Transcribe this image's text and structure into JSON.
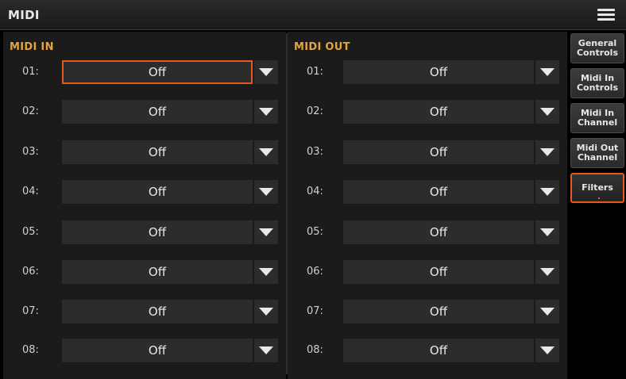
{
  "window": {
    "title": "MIDI",
    "menu_icon": "hamburger-menu-icon"
  },
  "midi_in": {
    "title": "MIDI IN",
    "rows": [
      {
        "label": "01:",
        "value": "Off"
      },
      {
        "label": "02:",
        "value": "Off"
      },
      {
        "label": "03:",
        "value": "Off"
      },
      {
        "label": "04:",
        "value": "Off"
      },
      {
        "label": "05:",
        "value": "Off"
      },
      {
        "label": "06:",
        "value": "Off"
      },
      {
        "label": "07:",
        "value": "Off"
      },
      {
        "label": "08:",
        "value": "Off"
      }
    ]
  },
  "midi_out": {
    "title": "MIDI OUT",
    "rows": [
      {
        "label": "01:",
        "value": "Off"
      },
      {
        "label": "02:",
        "value": "Off"
      },
      {
        "label": "03:",
        "value": "Off"
      },
      {
        "label": "04:",
        "value": "Off"
      },
      {
        "label": "05:",
        "value": "Off"
      },
      {
        "label": "06:",
        "value": "Off"
      },
      {
        "label": "07:",
        "value": "Off"
      },
      {
        "label": "08:",
        "value": "Off"
      }
    ]
  },
  "tabs": [
    {
      "label": "General Controls",
      "active": false
    },
    {
      "label": "Midi In Controls",
      "active": false
    },
    {
      "label": "Midi In Channel",
      "active": false
    },
    {
      "label": "Midi Out Channel",
      "active": false
    },
    {
      "label": "Filters",
      "active": true
    }
  ],
  "colors": {
    "accent": "#e55a1f",
    "section_title": "#e3a341"
  }
}
